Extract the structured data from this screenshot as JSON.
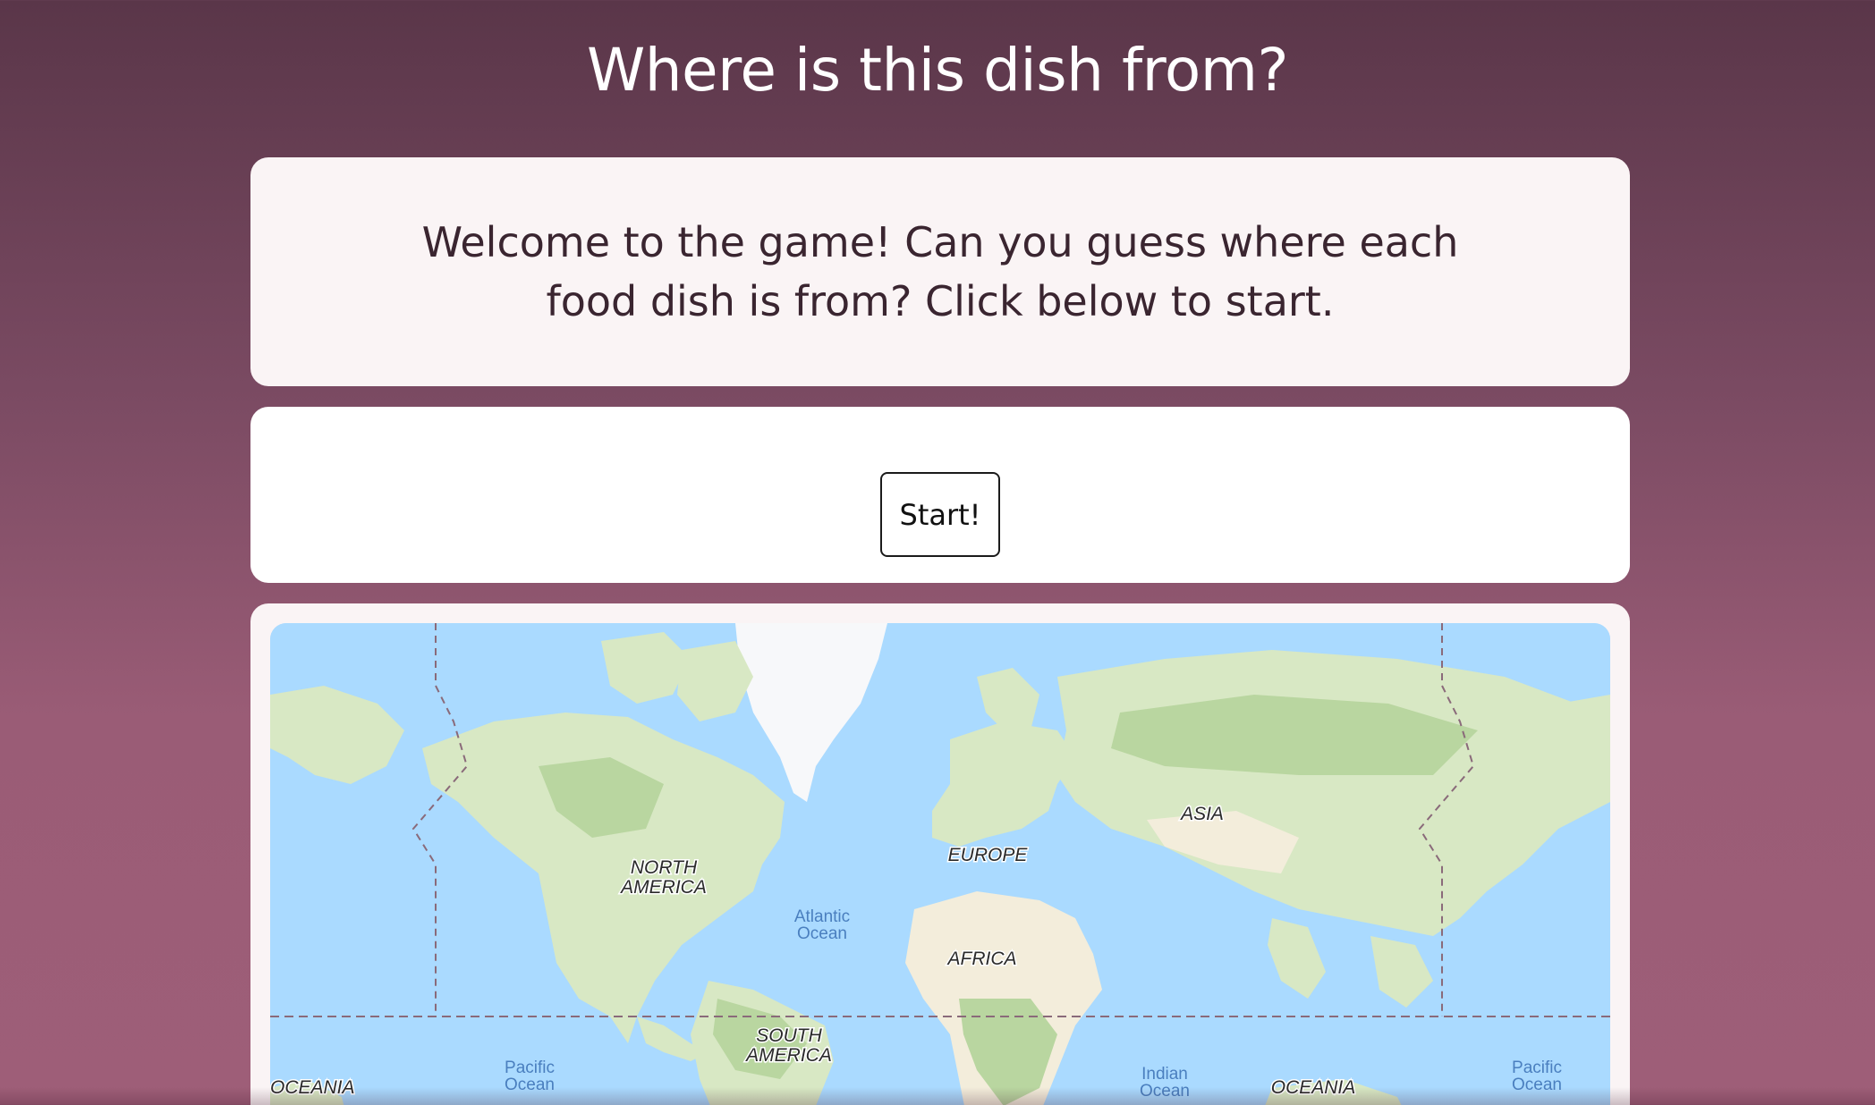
{
  "header": {
    "title": "Where is this dish from?"
  },
  "welcome": {
    "text": "Welcome to the game! Can you guess where each food dish is from? Click below to start."
  },
  "controls": {
    "start_label": "Start!"
  },
  "map": {
    "continents": {
      "north_america_line1": "NORTH",
      "north_america_line2": "AMERICA",
      "south_america_line1": "SOUTH",
      "south_america_line2": "AMERICA",
      "europe": "EUROPE",
      "asia": "ASIA",
      "africa": "AFRICA",
      "oceania_left": "OCEANIA",
      "oceania_right": "OCEANIA"
    },
    "oceans": {
      "atlantic_line1": "Atlantic",
      "atlantic_line2": "Ocean",
      "pacific_left_line1": "Pacific",
      "pacific_left_line2": "Ocean",
      "pacific_right_line1": "Pacific",
      "pacific_right_line2": "Ocean",
      "indian_line1": "Indian",
      "indian_line2": "Ocean"
    },
    "colors": {
      "water": "#aadaff",
      "land": "#d8e8c4",
      "forest": "#b9d6a0",
      "desert": "#f3eddb",
      "ice": "#f7f8fa",
      "borders": "#8a6a7a"
    }
  }
}
